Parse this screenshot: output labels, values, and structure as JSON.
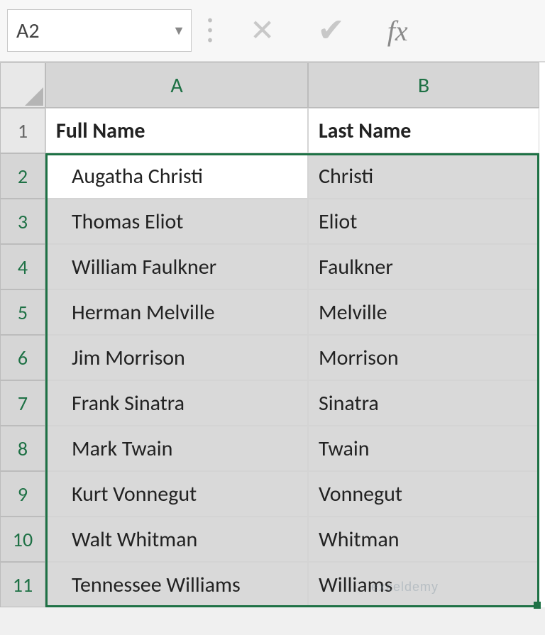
{
  "formula_bar": {
    "name_box": "A2",
    "cancel_icon": "✕",
    "enter_icon": "✔",
    "fx_label": "fx"
  },
  "columns": [
    "A",
    "B"
  ],
  "rows": [
    "1",
    "2",
    "3",
    "4",
    "5",
    "6",
    "7",
    "8",
    "9",
    "10",
    "11"
  ],
  "headers": {
    "A": "Full Name",
    "B": "Last Name"
  },
  "data": [
    {
      "A": "Augatha Christi",
      "B": "Christi"
    },
    {
      "A": "Thomas Eliot",
      "B": "Eliot"
    },
    {
      "A": "William Faulkner",
      "B": "Faulkner"
    },
    {
      "A": "Herman Melville",
      "B": "Melville"
    },
    {
      "A": "Jim Morrison",
      "B": "Morrison"
    },
    {
      "A": "Frank Sinatra",
      "B": "Sinatra"
    },
    {
      "A": "Mark Twain",
      "B": "Twain"
    },
    {
      "A": "Kurt Vonnegut",
      "B": "Vonnegut"
    },
    {
      "A": "Walt Whitman",
      "B": "Whitman"
    },
    {
      "A": "Tennessee Williams",
      "B": "Williams"
    }
  ],
  "selection": {
    "active_cell": "A2",
    "range": "A2:B11"
  },
  "watermark": "exceldemy"
}
